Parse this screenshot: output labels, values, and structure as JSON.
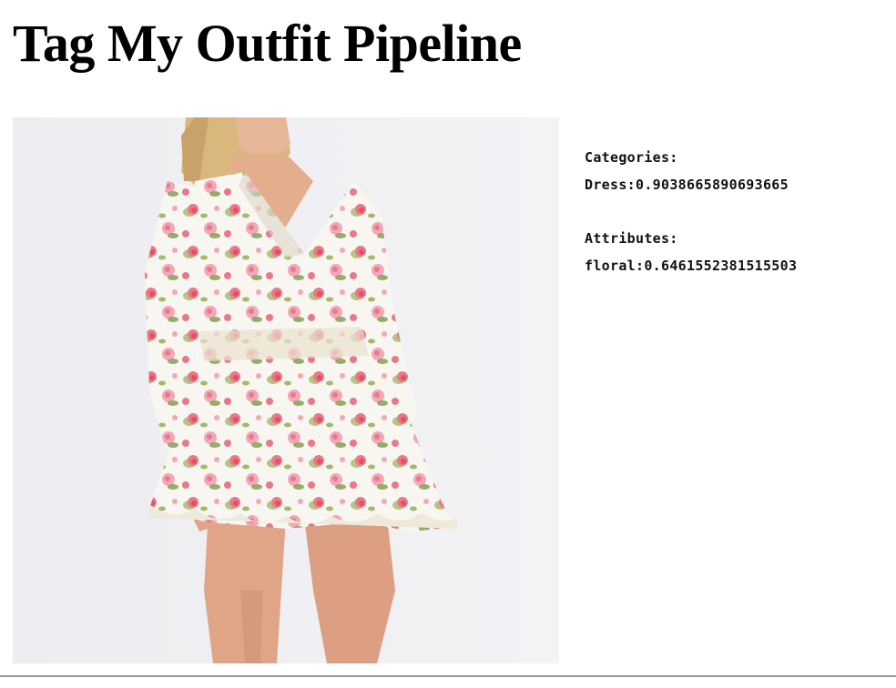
{
  "page": {
    "title": "Tag My Outfit Pipeline"
  },
  "image": {
    "icon": "outfit-photo",
    "background_color": "#eeeef2",
    "dress_base_color": "#f7f6f1",
    "flower_colors": [
      "#e9798a",
      "#f2a8b6",
      "#e6505e",
      "#a7b86a",
      "#7f9a4a"
    ]
  },
  "results": {
    "categories_heading": "Categories:",
    "categories": [
      {
        "label": "Dress",
        "score": "0.9038665890693665"
      }
    ],
    "attributes_heading": "Attributes:",
    "attributes": [
      {
        "label": "floral",
        "score": "0.6461552381515503"
      }
    ]
  }
}
